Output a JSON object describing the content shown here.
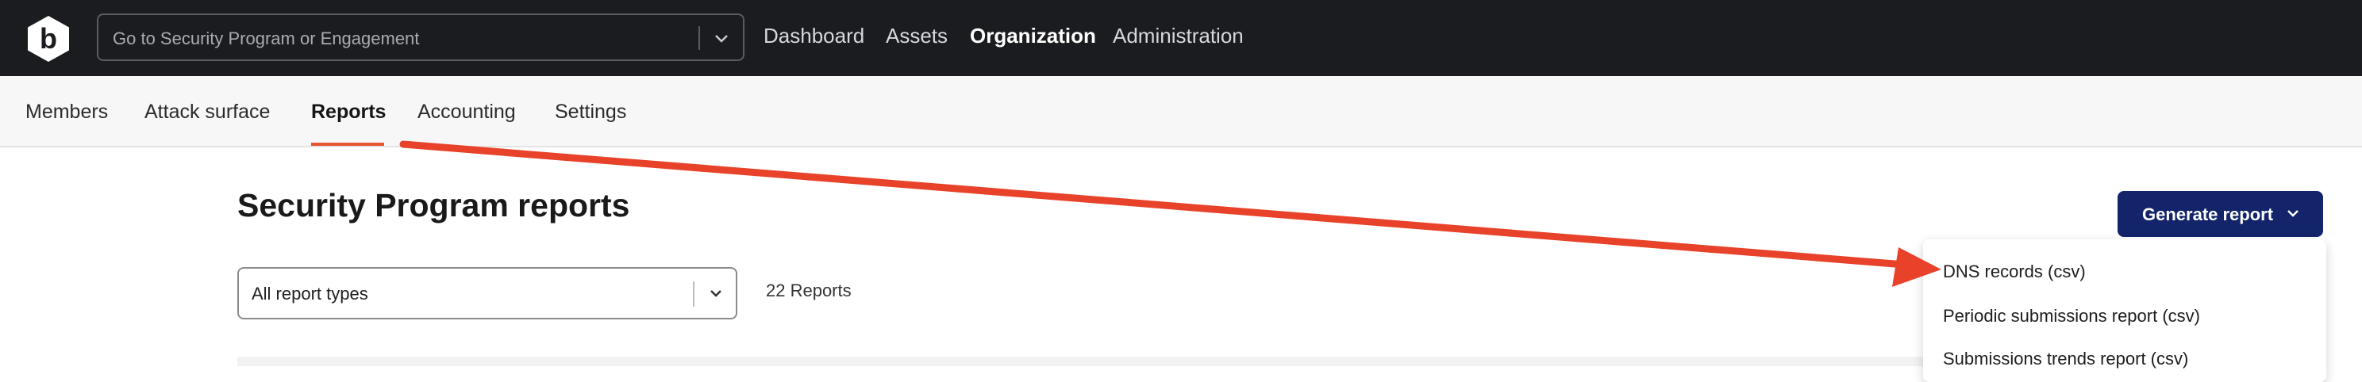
{
  "header": {
    "logo_letter": "b",
    "search": {
      "placeholder": "Go to Security Program or Engagement"
    },
    "nav": [
      {
        "label": "Dashboard",
        "active": false
      },
      {
        "label": "Assets",
        "active": false
      },
      {
        "label": "Organization",
        "active": true
      },
      {
        "label": "Administration",
        "active": false
      }
    ]
  },
  "tabs": [
    {
      "label": "Members",
      "active": false
    },
    {
      "label": "Attack surface",
      "active": false
    },
    {
      "label": "Reports",
      "active": true
    },
    {
      "label": "Accounting",
      "active": false
    },
    {
      "label": "Settings",
      "active": false
    }
  ],
  "main": {
    "title": "Security Program reports",
    "generate_button": "Generate report",
    "filter": {
      "value": "All report types"
    },
    "report_count": "22 Reports"
  },
  "menu": {
    "items": [
      "DNS records (csv)",
      "Periodic submissions report (csv)",
      "Submissions trends report (csv)"
    ]
  },
  "colors": {
    "topbar": "#1b1c1f",
    "accent_underline": "#e8562f",
    "primary_button": "#13246b",
    "annotation_arrow": "#e8432a"
  },
  "icons": {
    "logo": "bugcrowd-hexagon-logo-icon",
    "search_dropdown": "chevron-down-icon",
    "button_dropdown": "chevron-down-icon",
    "filter_dropdown": "chevron-down-icon"
  }
}
